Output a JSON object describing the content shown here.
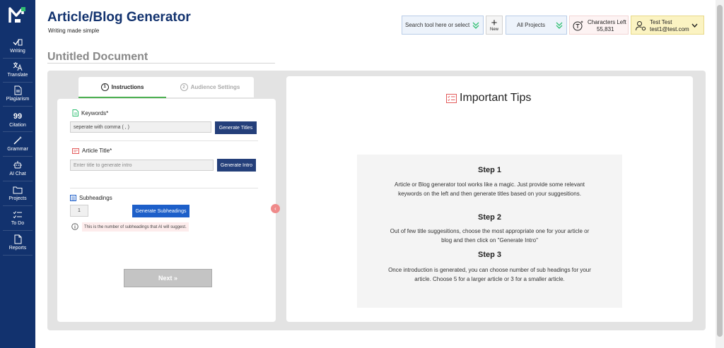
{
  "header": {
    "title": "Article/Blog Generator",
    "subtitle": "Writing made simple"
  },
  "sidebar": {
    "items": [
      {
        "label": "Writing",
        "icon": "pen-square-icon"
      },
      {
        "label": "Translate",
        "icon": "translate-icon"
      },
      {
        "label": "Plagiarism",
        "icon": "document-icon"
      },
      {
        "label": "Citation",
        "icon": "quote-icon"
      },
      {
        "label": "Grammar",
        "icon": "magic-wand-icon"
      },
      {
        "label": "AI Chat",
        "icon": "robot-icon"
      },
      {
        "label": "Projects",
        "icon": "folder-icon"
      },
      {
        "label": "To Do",
        "icon": "checklist-icon"
      },
      {
        "label": "Reports",
        "icon": "report-icon"
      }
    ]
  },
  "topbar": {
    "search_label": "Search tool here or select",
    "new_label": "New",
    "projects_label": "All Projects",
    "chars_label": "Characters Left",
    "chars_value": "55,831",
    "user_name": "Test Test",
    "user_email": "test1@test.com"
  },
  "document": {
    "title": "Untitled Document"
  },
  "tabs": [
    {
      "num": "1",
      "label": "Instructions"
    },
    {
      "num": "2",
      "label": "Audience Settings"
    }
  ],
  "form": {
    "keywords_label": "Keywords*",
    "keywords_value": "seperate with comma ( , )",
    "generate_titles": "Generate Titles",
    "article_title_label": "Article Title*",
    "article_title_placeholder": "Enter title to generate intro",
    "generate_intro": "Generate Intro",
    "subheadings_label": "Subheadings",
    "subheadings_value": "1",
    "generate_subheadings": "Generate Subheadings",
    "subheadings_note": "This is the number of subheadings that AI will suggest.",
    "next_label": "Next »"
  },
  "tips": {
    "title": "Important Tips",
    "steps": [
      {
        "heading": "Step 1",
        "text": "Article or Blog generator tool works like a magic. Just provide some relevant keywords on the left and then generate titles based on your suggesitions."
      },
      {
        "heading": "Step 2",
        "text": "Out of few title suggesitions, choose the most appropriate one for your article or blog and then click on \"Generate Intro\""
      },
      {
        "heading": "Step 3",
        "text": "Once introduction is generated, you can choose number of sub headings for your article. Choose 5 for a larger article or 3 for a smaller article."
      }
    ]
  },
  "colors": {
    "sidebar": "#12326e",
    "accent_green": "#4caf50",
    "button_dark": "#243f7a",
    "button_blue": "#1d5fc9"
  }
}
